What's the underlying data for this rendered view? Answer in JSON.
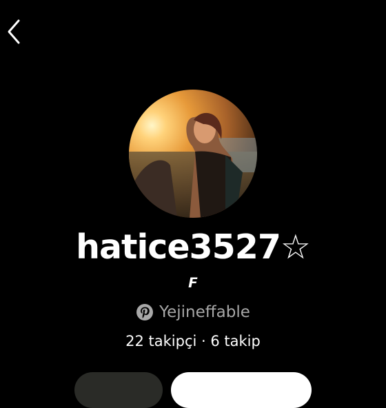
{
  "header": {
    "back_icon": "chevron-left-icon"
  },
  "profile": {
    "avatar_alt": "profile photo",
    "username": "hatice3527☆",
    "bio": "𝙁",
    "website_icon": "pinterest-icon",
    "website": "Yejineffable",
    "stats": "22 takipçi · 6 takip"
  },
  "actions": {
    "message_label": "",
    "follow_label": ""
  },
  "colors": {
    "background": "#000000",
    "text_primary": "#ffffff",
    "text_secondary": "#a8a8a8",
    "button_dark": "#2a2b27",
    "button_light": "#ffffff"
  }
}
